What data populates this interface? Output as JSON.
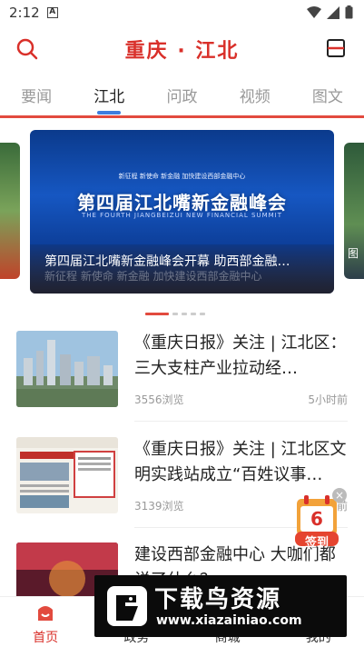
{
  "status_bar": {
    "time": "2:12",
    "notif": "A"
  },
  "header": {
    "title": "重庆 · 江北"
  },
  "tabs": [
    {
      "label": "要闻"
    },
    {
      "label": "江北",
      "active": true
    },
    {
      "label": "问政"
    },
    {
      "label": "视频"
    },
    {
      "label": "图文"
    }
  ],
  "banner": {
    "top_text": "新征程 新使命 新金融 加快建设西部金融中心",
    "main_title": "第四届江北嘴新金融峰会",
    "sub_title": "THE FOURTH JIANGBEIZUI NEW FINANCIAL SUMMIT",
    "caption": "第四届江北嘴新金融峰会开幕 助西部金融…",
    "watermark": "新征程 新使命 新金融 加快建设西部金融中心",
    "right_label": "图"
  },
  "carousel": {
    "count": 5,
    "active_index": 0
  },
  "news": [
    {
      "title": "《重庆日报》关注 | 江北区：三大支柱产业拉动经…",
      "views": "3556浏览",
      "time": "5小时前"
    },
    {
      "title": "《重庆日报》关注 | 江北区文明实践站成立“百姓议事…",
      "views": "3139浏览",
      "time": "前"
    },
    {
      "title": "建设西部金融中心 大咖们都说了什么？",
      "views": "",
      "time": ""
    }
  ],
  "sign_in": {
    "day": "6",
    "label": "签到"
  },
  "bottom_nav": [
    {
      "label": "首页",
      "active": true
    },
    {
      "label": "政务"
    },
    {
      "label": "商城"
    },
    {
      "label": "我的"
    }
  ],
  "watermark": {
    "title": "下载鸟资源",
    "url": "www.xiazainiao.com"
  },
  "colors": {
    "brand": "#d9302a",
    "tab_indicator": "#3d7ddf"
  }
}
